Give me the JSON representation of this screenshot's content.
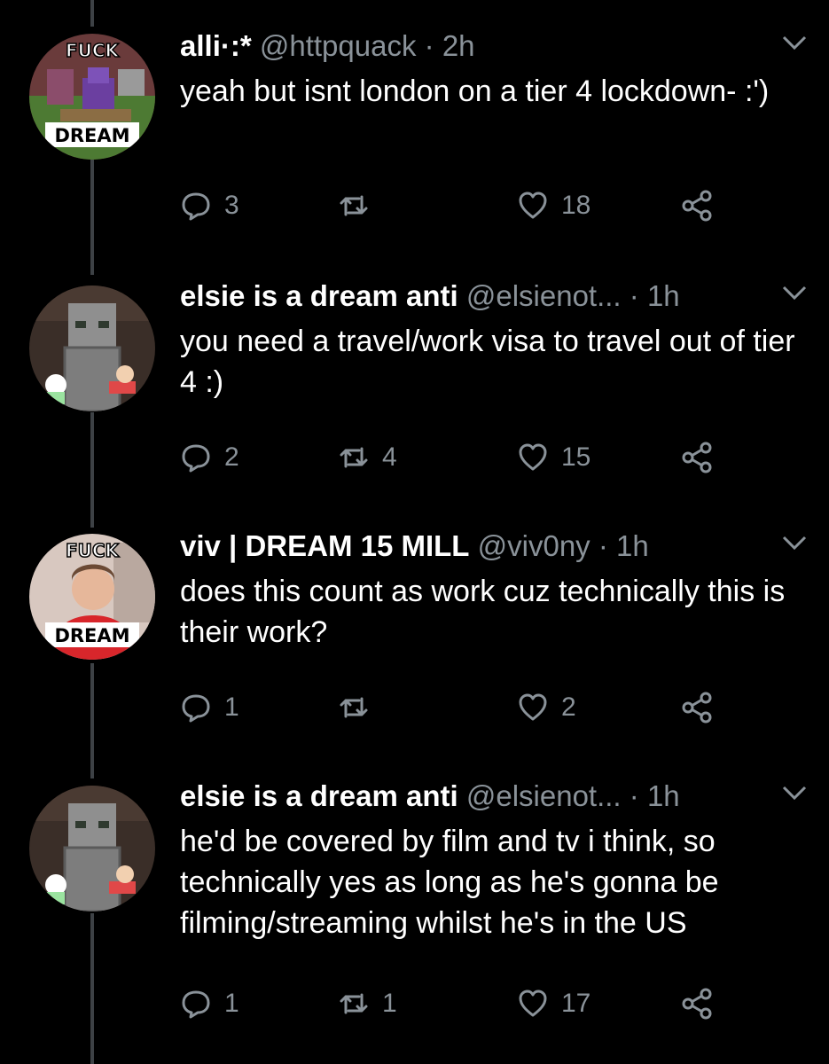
{
  "tweets": [
    {
      "display_name": "alli·:*",
      "handle": "@httpquack",
      "separator": "·",
      "time": "2h",
      "text": "yeah but isnt london on a tier 4 lockdown- :')",
      "replies": "3",
      "retweets": "",
      "likes": "18",
      "avatar_text_top": "FUCK",
      "avatar_text_bottom": "DREAM"
    },
    {
      "display_name": "elsie is a dream anti",
      "handle": "@elsienot...",
      "separator": "·",
      "time": "1h",
      "text": "you need a travel/work visa to travel out of tier 4 :)",
      "replies": "2",
      "retweets": "4",
      "likes": "15",
      "avatar_text_top": "",
      "avatar_text_bottom": ""
    },
    {
      "display_name": "viv | DREAM 15 MILL",
      "handle": "@viv0ny",
      "separator": "·",
      "time": "1h",
      "text": "does this count as work cuz technically this is their work?",
      "replies": "1",
      "retweets": "",
      "likes": "2",
      "avatar_text_top": "FUCK",
      "avatar_text_bottom": "DREAM"
    },
    {
      "display_name": "elsie is a dream anti",
      "handle": "@elsienot...",
      "separator": "·",
      "time": "1h",
      "text": "he'd be covered by film and tv i think, so technically yes as long as he's gonna be filming/streaming whilst he's in the US",
      "replies": "1",
      "retweets": "1",
      "likes": "17",
      "avatar_text_top": "",
      "avatar_text_bottom": ""
    }
  ],
  "colors": {
    "background": "#000000",
    "text": "#ffffff",
    "muted": "#8a9299",
    "thread_line": "#3d4145"
  },
  "icons": [
    "reply-icon",
    "retweet-icon",
    "like-icon",
    "share-icon",
    "chevron-down-icon"
  ]
}
